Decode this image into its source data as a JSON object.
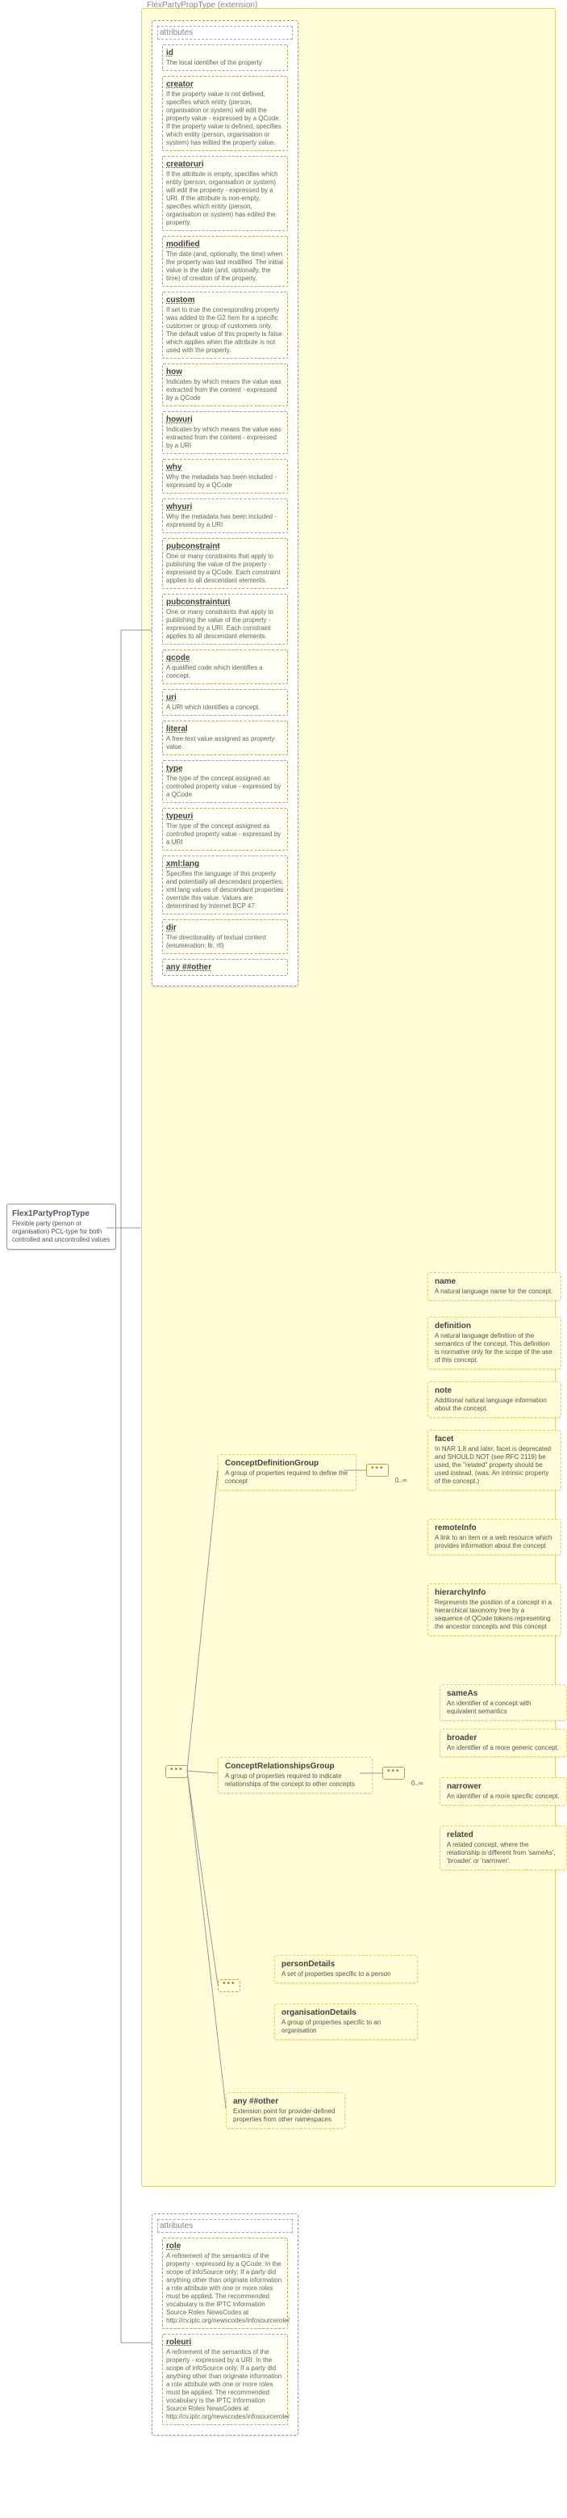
{
  "main": {
    "name": "Flex1PartyPropType",
    "desc": "Flexible party (person or organisation) PCL-type for both controlled and uncontrolled values",
    "ext": "FlexPartyPropType (extension)"
  },
  "attributes": [
    {
      "n": "id",
      "d": "The local identifier of the property"
    },
    {
      "n": "creator",
      "d": "If the property value is not defined, specifies which entity (person, organisation or system) will edit the property value - expressed by a QCode. If the property value is defined, specifies which entity (person, organisation or system) has edited the property value."
    },
    {
      "n": "creatoruri",
      "d": "If the attribute is empty, specifies which entity (person, organisation or system) will edit the property - expressed by a URI. If the attribute is non-empty, specifies which entity (person, organisation or system) has edited the property."
    },
    {
      "n": "modified",
      "d": "The date (and, optionally, the time) when the property was last modified. The initial value is the date (and, optionally, the time) of creation of the property."
    },
    {
      "n": "custom",
      "d": "If set to true the corresponding property was added to the G2 Item for a specific customer or group of customers only. The default value of this property is false which applies when the attribute is not used with the property."
    },
    {
      "n": "how",
      "d": "Indicates by which means the value was extracted from the content - expressed by a QCode"
    },
    {
      "n": "howuri",
      "d": "Indicates by which means the value was extracted from the content - expressed by a URI"
    },
    {
      "n": "why",
      "d": "Why the metadata has been included - expressed by a QCode"
    },
    {
      "n": "whyuri",
      "d": "Why the metadata has been included - expressed by a URI"
    },
    {
      "n": "pubconstraint",
      "d": "One or many constraints that apply to publishing the value of the property - expressed by a QCode. Each constraint applies to all descendant elements."
    },
    {
      "n": "pubconstrainturi",
      "d": "One or many constraints that apply to publishing the value of the property - expressed by a URI. Each constraint applies to all descendant elements."
    },
    {
      "n": "qcode",
      "d": "A qualified code which identifies a concept."
    },
    {
      "n": "uri",
      "d": "A URI which identifies a concept."
    },
    {
      "n": "literal",
      "d": "A free-text value assigned as property value."
    },
    {
      "n": "type",
      "d": "The type of the concept assigned as controlled property value - expressed by a QCode"
    },
    {
      "n": "typeuri",
      "d": "The type of the concept assigned as controlled property value - expressed by a URI"
    },
    {
      "n": "xml:lang",
      "d": "Specifies the language of this property and potentially all descendant properties. xml:lang values of descendant properties override this value. Values are determined by Internet BCP 47."
    },
    {
      "n": "dir",
      "d": "The directionality of textual content (enumeration: ltr, rtl)"
    },
    {
      "n": "any ##other",
      "d": ""
    }
  ],
  "groups": {
    "cdef": {
      "name": "ConceptDefinitionGroup",
      "desc": "A group of properties required to define the concept",
      "occ": "0..∞",
      "items": [
        {
          "n": "name",
          "d": "A natural language name for the concept."
        },
        {
          "n": "definition",
          "d": "A natural language definition of the semantics of the concept. This definition is normative only for the scope of the use of this concept."
        },
        {
          "n": "note",
          "d": "Additional natural language information about the concept."
        },
        {
          "n": "facet",
          "d": "In NAR 1.8 and later, facet is deprecated and SHOULD NOT (see RFC 2119) be used, the \"related\" property should be used instead. (was: An intrinsic property of the concept.)"
        },
        {
          "n": "remoteInfo",
          "d": "A link to an item or a web resource which provides information about the concept"
        },
        {
          "n": "hierarchyInfo",
          "d": "Represents the position of a concept in a hierarchical taxonomy tree by a sequence of QCode tokens representing the ancestor concepts and this concept"
        }
      ]
    },
    "crel": {
      "name": "ConceptRelationshipsGroup",
      "desc": "A group of properties required to indicate relationships of the concept to other concepts",
      "occ": "0..∞",
      "items": [
        {
          "n": "sameAs",
          "d": "An identifier of a concept with equivalent semantics"
        },
        {
          "n": "broader",
          "d": "An identifier of a more generic concept."
        },
        {
          "n": "narrower",
          "d": "An identifier of a more specific concept."
        },
        {
          "n": "related",
          "d": "A related concept, where the relationship is different from 'sameAs', 'broader' or 'narrower'."
        }
      ]
    }
  },
  "choice": {
    "items": [
      {
        "n": "personDetails",
        "d": "A set of properties specific to a person"
      },
      {
        "n": "organisationDetails",
        "d": "A group of properties specific to an organisation"
      }
    ]
  },
  "any2": {
    "n": "any ##other",
    "d": "Extension point for provider-defined properties from other namespaces"
  },
  "attributes2": [
    {
      "n": "role",
      "d": "A refinement of the semantics of the property - expressed by a QCode. In the scope of infoSource only: If a party did anything other than originate information a role attribute with one or more roles must be applied. The recommended vocabulary is the IPTC Information Source Roles NewsCodes at http://cv.iptc.org/newscodes/infosourcerole/"
    },
    {
      "n": "roleuri",
      "d": "A refinement of the semantics of the property - expressed by a URI. In the scope of infoSource only: If a party did anything other than originate information a role attribute with one or more roles must be applied. The recommended vocabulary is the IPTC Information Source Roles NewsCodes at http://cv.iptc.org/newscodes/infosourcerole/"
    }
  ]
}
